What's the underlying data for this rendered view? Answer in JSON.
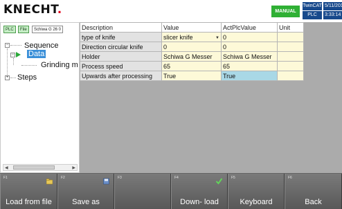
{
  "header": {
    "logo": "KNECHT",
    "mode": "MANUAL",
    "twincat": "TwinCAT",
    "plc": "PLC",
    "date": "5/11/2017",
    "time": "3:33:14 PM"
  },
  "left_panel": {
    "tags": [
      "PLC",
      "File",
      "Schiwa G 26 0"
    ],
    "tree": {
      "sequence": "Sequence",
      "data": "Data",
      "grinding": "Grinding m",
      "steps": "Steps"
    },
    "scroll_marker": "III"
  },
  "grid": {
    "headers": [
      "Description",
      "Value",
      "ActPlcValue",
      "Unit"
    ],
    "rows": [
      {
        "description": "type of knife",
        "value": "slicer knife",
        "act": "0",
        "unit": ""
      },
      {
        "description": "Direction circular knife",
        "value": "0",
        "act": "0",
        "unit": ""
      },
      {
        "description": "Holder",
        "value": "Schiwa G Messer",
        "act": "Schiwa G Messer",
        "unit": ""
      },
      {
        "description": "Process speed",
        "value": "65",
        "act": "65",
        "unit": ""
      },
      {
        "description": "Upwards after processing",
        "value": "True",
        "act": "True",
        "unit": ""
      }
    ]
  },
  "function_keys": [
    {
      "num": "F1",
      "label": "Load  from file",
      "icon": "folder-icon"
    },
    {
      "num": "F2",
      "label": "Save as",
      "icon": "save-icon"
    },
    {
      "num": "F3",
      "label": "",
      "icon": ""
    },
    {
      "num": "F4",
      "label": "Down- load",
      "icon": "check-icon"
    },
    {
      "num": "F5",
      "label": "Keyboard",
      "icon": ""
    },
    {
      "num": "F6",
      "label": "Back",
      "icon": ""
    }
  ],
  "colors": {
    "mode_badge": "#2fb034",
    "header_cells": "#17498c",
    "selected_tree": "#3a8fd8",
    "grid_background": "#ababab"
  }
}
